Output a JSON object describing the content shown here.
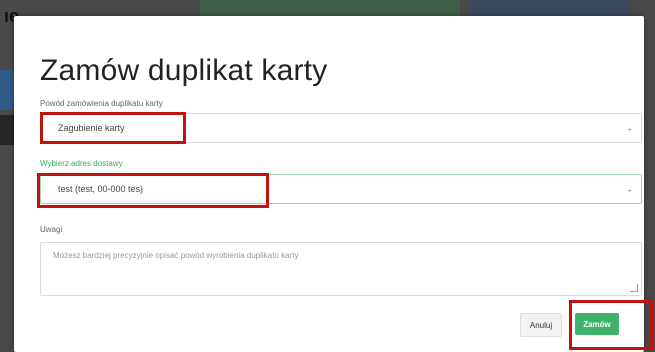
{
  "modal": {
    "title": "Zamów duplikat karty",
    "reason": {
      "label": "Powód zamówienia duplikatu karty",
      "value": "Zagubienie karty"
    },
    "address": {
      "label": "Wybierz adres dostawy",
      "value": "test (test, 00-000 tes)"
    },
    "notes": {
      "label": "Uwagi",
      "placeholder": "Możesz bardziej precyzyjnie opisać powód wyrobienia duplikatu karty"
    },
    "buttons": {
      "cancel": "Anuluj",
      "order": "Zamów"
    }
  },
  "background": {
    "fragment": "ıe"
  },
  "colors": {
    "accent_green": "#3fb26b",
    "highlight_red": "#c0120f",
    "active_label_green": "#3aa85a"
  },
  "icons": {
    "select_chevron": "chevron-down-icon"
  }
}
